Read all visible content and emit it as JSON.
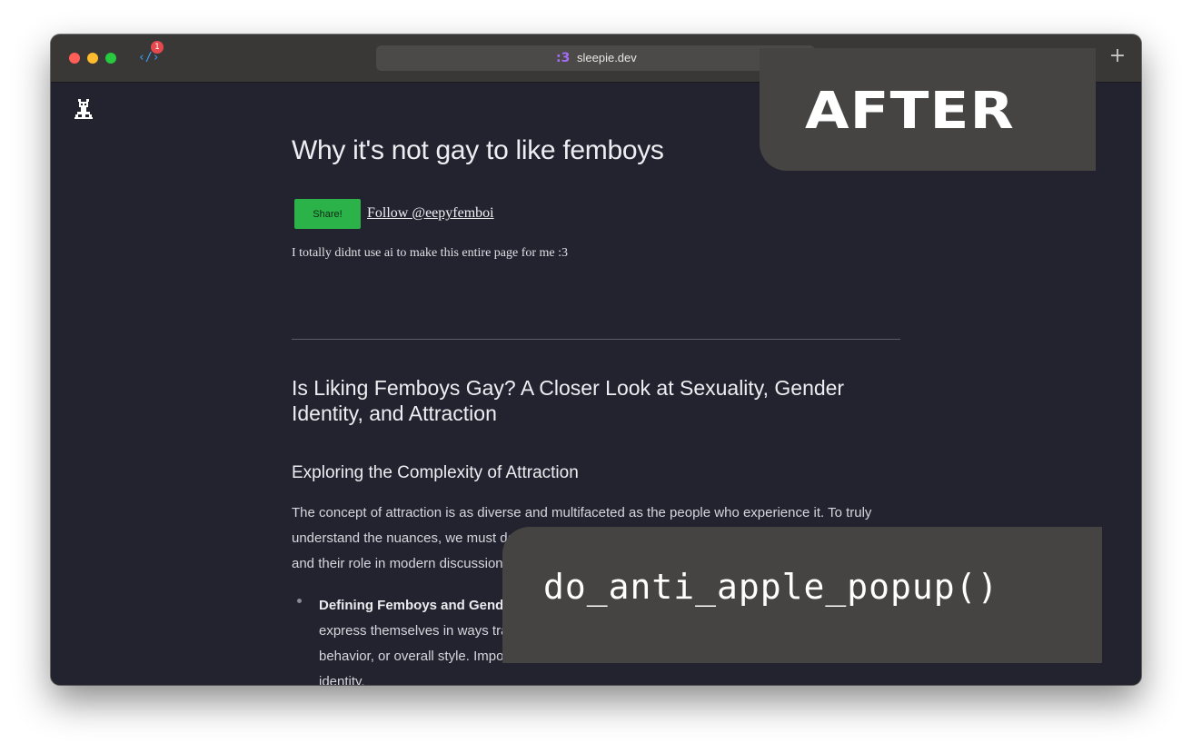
{
  "browser": {
    "devtools_badge": "1",
    "url": "sleepie.dev",
    "favicon_text": ":3",
    "new_tab_label": "+"
  },
  "page": {
    "title": "Why it's not gay to like femboys",
    "share_label": "Share!",
    "follow_label": "Follow @eepyfemboi",
    "tagline": "I totally didnt use ai to make this entire page for me :3",
    "heading": "Is Liking Femboys Gay? A Closer Look at Sexuality, Gender Identity, and Attraction",
    "subheading": "Exploring the Complexity of Attraction",
    "paragraph": "The concept of attraction is as diverse and multifaceted as the people who experience it. To truly understand the nuances, we must delve into the specifics, starting with the intriguing rise of femboys and their role in modern discussions about gender and sexuality.",
    "list": [
      {
        "bold": "Defining Femboys and Gender Expression:",
        "text": " Femboys are individuals who identify as male but express themselves in ways traditionally associated with femininity —be it through their clothing, behavior, or overall style. Importantly, being a femboy is not about changing one's gender identity."
      }
    ]
  },
  "overlays": {
    "after_label": "AFTER",
    "code_label": "do_anti_apple_popup()"
  },
  "colors": {
    "page_bg": "#23222f",
    "titlebar": "#3a3836",
    "share_button": "#2bb34a",
    "overlay_panel": "#454442"
  }
}
